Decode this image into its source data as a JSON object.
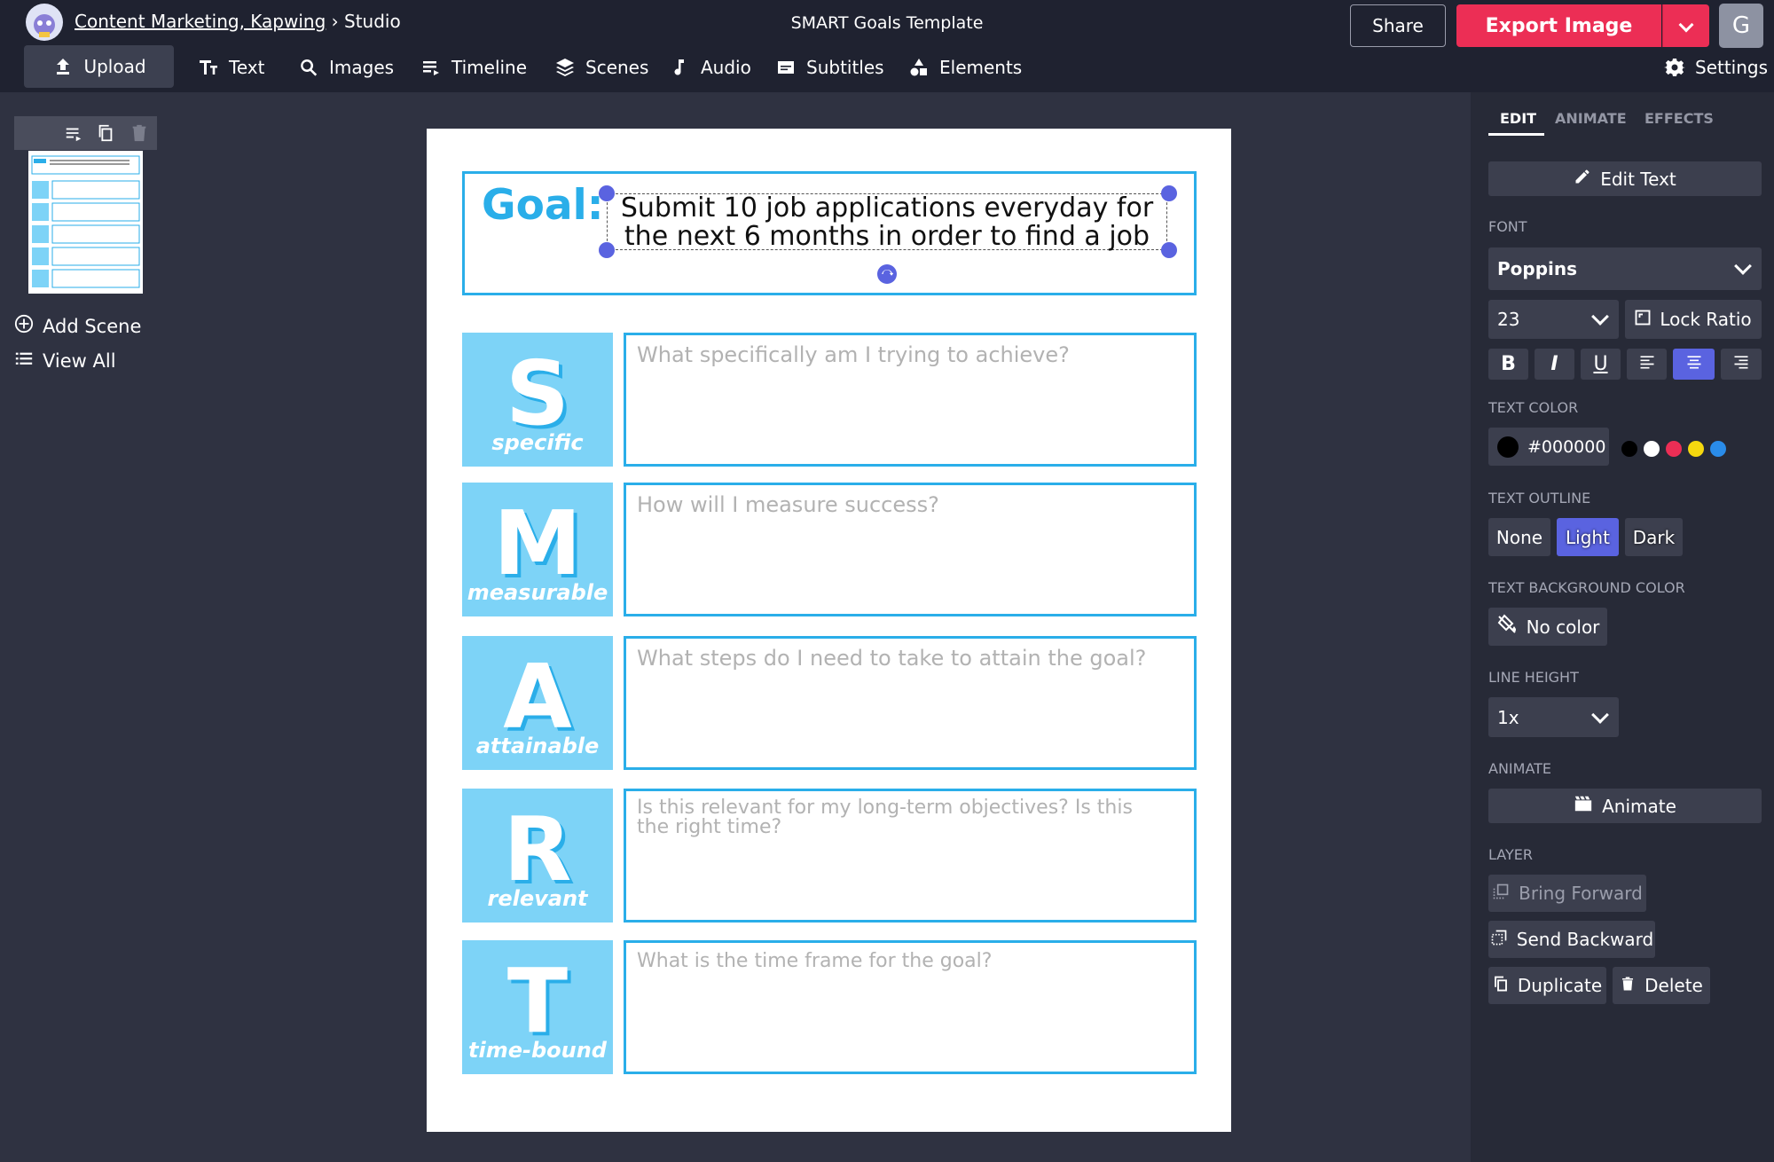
{
  "header": {
    "breadcrumb_workspace": "Content Marketing, Kapwing",
    "breadcrumb_sep": "›",
    "breadcrumb_page": "Studio",
    "doc_title": "SMART Goals Template",
    "share_label": "Share",
    "export_label": "Export Image",
    "user_initial": "G"
  },
  "toolbar": {
    "upload": "Upload",
    "text": "Text",
    "images": "Images",
    "timeline": "Timeline",
    "scenes": "Scenes",
    "audio": "Audio",
    "subtitles": "Subtitles",
    "elements": "Elements",
    "settings": "Settings"
  },
  "sidebar": {
    "add_scene": "Add Scene",
    "view_all": "View All"
  },
  "canvas": {
    "goal_label": "Goal:",
    "goal_text": "Submit 10 job applications everyday for the next 6 months in order to find a job",
    "rows": [
      {
        "letter": "S",
        "word": "specific",
        "prompt": "What specifically am I trying to achieve?"
      },
      {
        "letter": "M",
        "word": "measurable",
        "prompt": "How will I measure success?"
      },
      {
        "letter": "A",
        "word": "attainable",
        "prompt": "What steps do I need to take to attain the goal?"
      },
      {
        "letter": "R",
        "word": "relevant",
        "prompt": "Is this relevant for my long-term objectives? Is this the right time?"
      },
      {
        "letter": "T",
        "word": "time-bound",
        "prompt": "What is the time frame for the goal?"
      }
    ],
    "accent_color": "#2aaee9",
    "tile_color": "#7dd3f7"
  },
  "panel": {
    "tabs": [
      "EDIT",
      "ANIMATE",
      "EFFECTS"
    ],
    "edit_text": "Edit Text",
    "font_label": "FONT",
    "font_value": "Poppins",
    "size_value": "23",
    "lock_ratio": "Lock Ratio",
    "text_color_label": "TEXT COLOR",
    "text_color_value": "#000000",
    "outline_label": "TEXT OUTLINE",
    "outline_none": "None",
    "outline_light": "Light",
    "outline_dark": "Dark",
    "bg_color_label": "TEXT BACKGROUND COLOR",
    "bg_color_value": "No color",
    "line_height_label": "LINE HEIGHT",
    "line_height_value": "1x",
    "animate_label": "ANIMATE",
    "animate_btn": "Animate",
    "layer_label": "LAYER",
    "bring_forward": "Bring Forward",
    "send_backward": "Send Backward",
    "duplicate": "Duplicate",
    "delete": "Delete"
  }
}
